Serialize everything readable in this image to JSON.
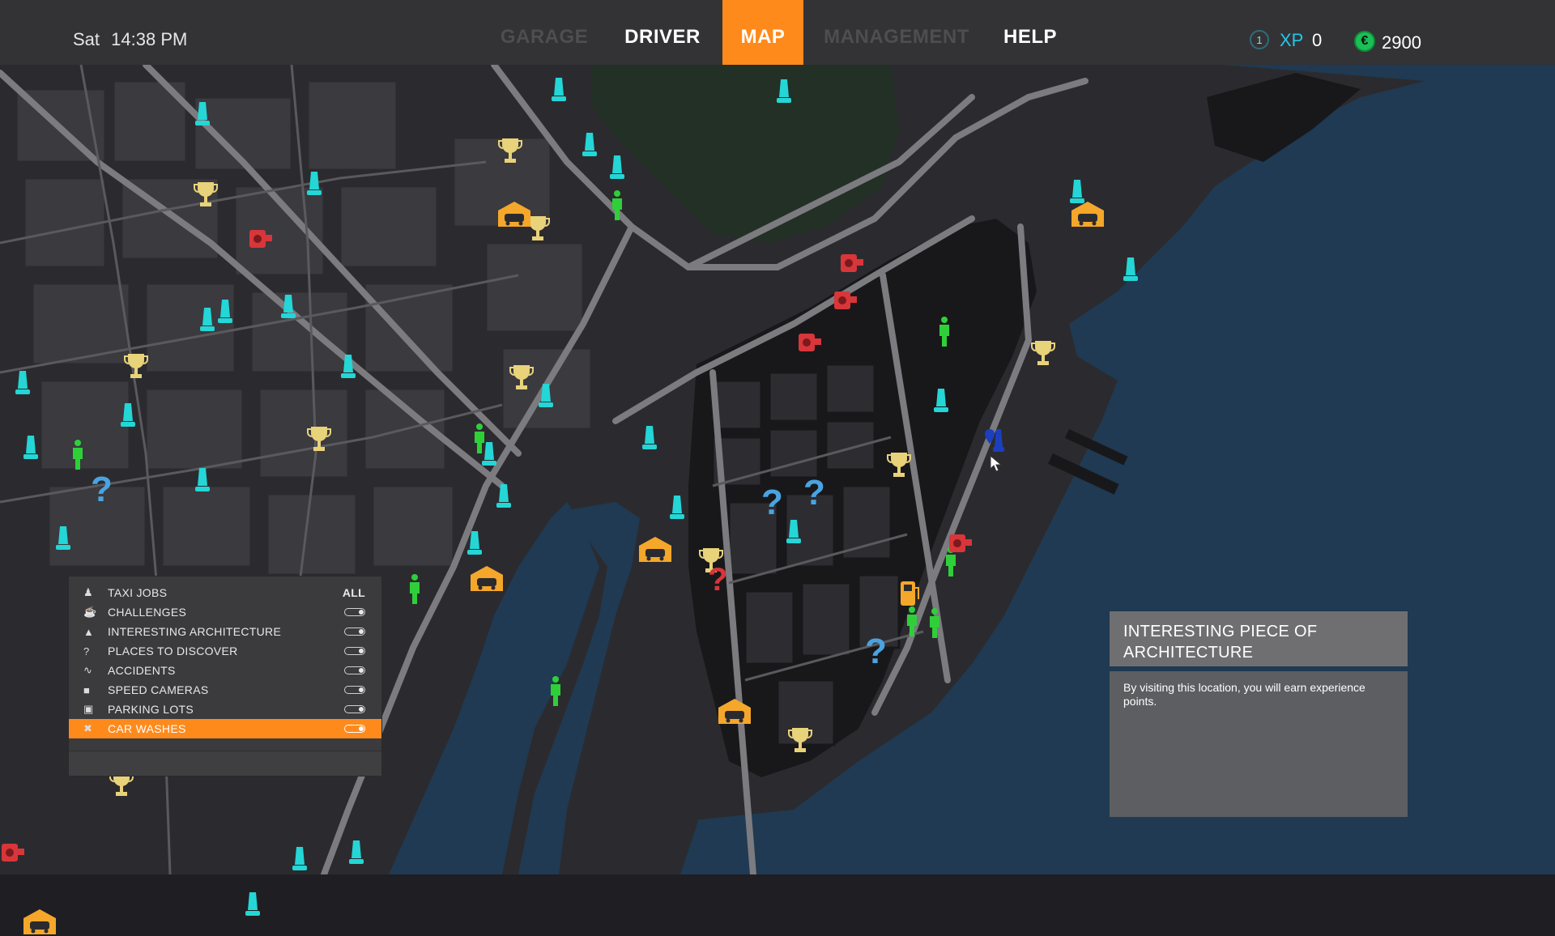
{
  "header": {
    "day": "Sat",
    "time": "14:38 PM",
    "tabs": [
      {
        "label": "GARAGE",
        "state": "disabled"
      },
      {
        "label": "DRIVER",
        "state": "enabled"
      },
      {
        "label": "MAP",
        "state": "active"
      },
      {
        "label": "MANAGEMENT",
        "state": "disabled"
      },
      {
        "label": "HELP",
        "state": "enabled"
      }
    ],
    "level": "1",
    "xp_label": "XP",
    "xp_value": "0",
    "currency_symbol": "€",
    "money": "2900"
  },
  "filters": {
    "items": [
      {
        "label": "TAXI JOBS",
        "icon": "person-icon",
        "control": "ALL"
      },
      {
        "label": "CHALLENGES",
        "icon": "trophy-icon",
        "control": "toggle"
      },
      {
        "label": "INTERESTING ARCHITECTURE",
        "icon": "monument-icon",
        "control": "toggle"
      },
      {
        "label": "PLACES TO DISCOVER",
        "icon": "question-icon",
        "control": "toggle"
      },
      {
        "label": "ACCIDENTS",
        "icon": "accident-icon",
        "control": "toggle"
      },
      {
        "label": "SPEED CAMERAS",
        "icon": "camera-icon",
        "control": "toggle"
      },
      {
        "label": "PARKING LOTS",
        "icon": "parking-icon",
        "control": "toggle"
      },
      {
        "label": "CAR WASHES",
        "icon": "wash-icon",
        "control": "toggle",
        "selected": true
      }
    ]
  },
  "info_panel": {
    "title": "INTERESTING PIECE OF ARCHITECTURE",
    "body": "By visiting this location, you will earn experience points."
  },
  "colors": {
    "accent": "#ff8a1c",
    "architecture": "#24d6d6",
    "challenge": "#e8d27a",
    "taxi_job": "#2fcf3a",
    "discover": "#4aa3e0",
    "speed_camera": "#d8363a",
    "car_wash": "#f4a72a",
    "water": "#1f3a52"
  }
}
